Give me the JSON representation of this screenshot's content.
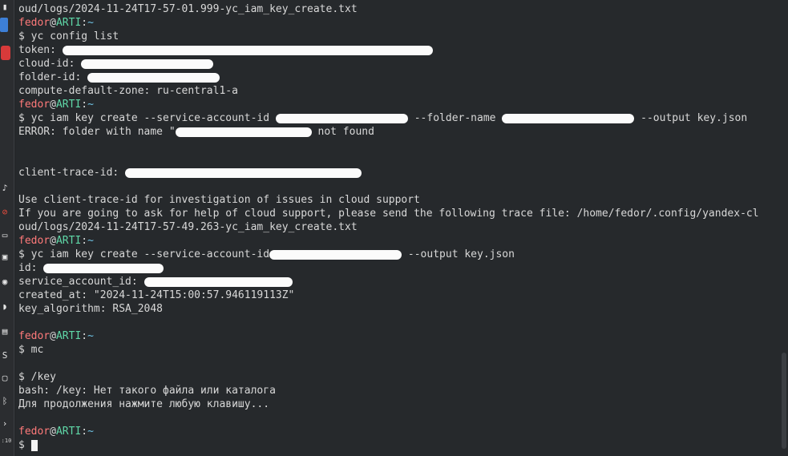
{
  "prompt": {
    "user": "fedor",
    "at": "@",
    "host": "ARTI",
    "sep": ":",
    "path": "~",
    "symbol": "$"
  },
  "lines": {
    "l1": "oud/logs/2024-11-24T17-57-01.999-yc_iam_key_create.txt",
    "cmd_config": "yc config list",
    "token": "token:",
    "cloud_id": "cloud-id:",
    "folder_id": "folder-id:",
    "zone": "compute-default-zone: ru-central1-a",
    "cmd_create1_a": "yc iam key create --service-account-id",
    "cmd_create1_b": "--folder-name",
    "cmd_create1_c": "--output key.json",
    "err_a": "ERROR: folder with name \"",
    "err_b": " not found",
    "trace": "client-trace-id:",
    "use_trace": "Use client-trace-id for investigation of issues in cloud support",
    "help": "If you are going to ask for help of cloud support, please send the following trace file: /home/fedor/.config/yandex-cl",
    "help2": "oud/logs/2024-11-24T17-57-49.263-yc_iam_key_create.txt",
    "cmd_create2_a": "yc iam key create --service-account-id",
    "cmd_create2_b": " --output key.json",
    "id": "id:",
    "sa_id": "service_account_id:",
    "created": "created_at: \"2024-11-24T15:00:57.946119113Z\"",
    "algo": "key_algorithm: RSA_2048",
    "cmd_mc": "mc",
    "key_cmd": "$ /key",
    "bash_err": "bash: /key: Нет такого файла или каталога",
    "continue": "Для продолжения нажмите любую клавишу..."
  },
  "taskbar": {
    "clock": ":10"
  }
}
